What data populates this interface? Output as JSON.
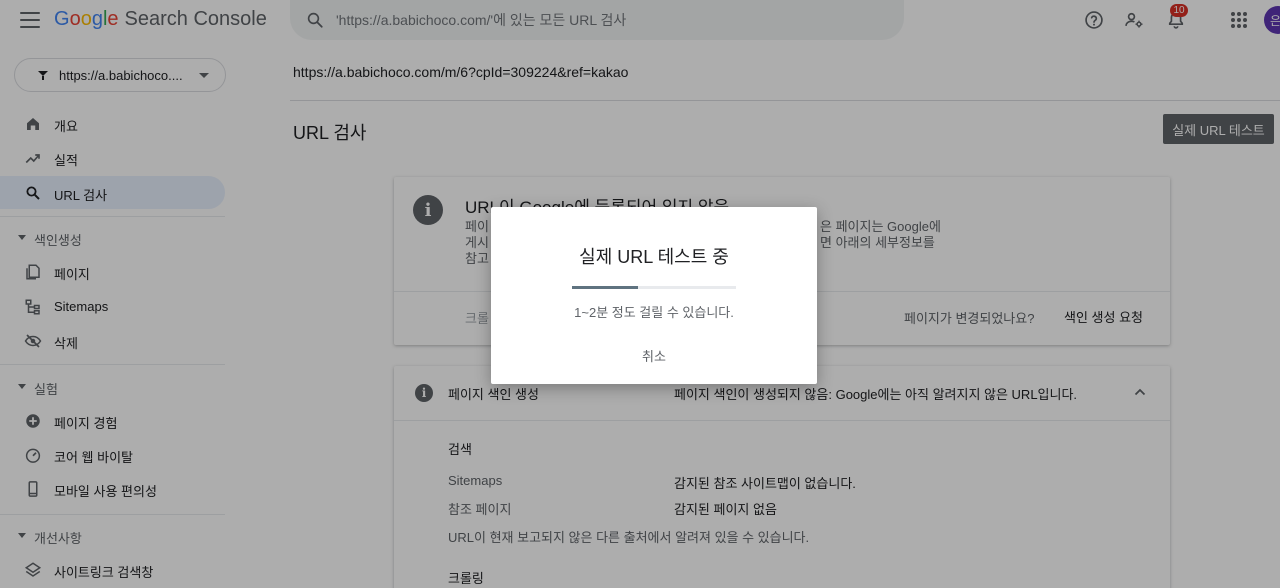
{
  "header": {
    "logo_google": [
      "G",
      "o",
      "o",
      "g",
      "l",
      "e"
    ],
    "logo_product": "Search Console",
    "search_placeholder": "'https://a.babichoco.com/'에 있는 모든 URL 검사",
    "notification_count": "10",
    "avatar_initial": "은"
  },
  "property": {
    "label": "https://a.babichoco...."
  },
  "sidebar": {
    "items": [
      {
        "label": "개요",
        "icon": "home-icon"
      },
      {
        "label": "실적",
        "icon": "trending-icon"
      },
      {
        "label": "URL 검사",
        "icon": "search-icon",
        "active": true
      }
    ],
    "sections": [
      {
        "label": "색인생성",
        "items": [
          {
            "label": "페이지",
            "icon": "pages-icon"
          },
          {
            "label": "Sitemaps",
            "icon": "sitemap-icon"
          },
          {
            "label": "삭제",
            "icon": "removal-icon"
          }
        ]
      },
      {
        "label": "실험",
        "items": [
          {
            "label": "페이지 경험",
            "icon": "plus-circle-icon"
          },
          {
            "label": "코어 웹 바이탈",
            "icon": "gauge-icon"
          },
          {
            "label": "모바일 사용 편의성",
            "icon": "mobile-icon"
          }
        ]
      },
      {
        "label": "개선사항",
        "items": [
          {
            "label": "사이트링크 검색창",
            "icon": "layers-icon"
          }
        ]
      }
    ]
  },
  "main": {
    "inspected_url": "https://a.babichoco.com/m/6?cpId=309224&ref=kakao",
    "page_title": "URL 검사",
    "live_test_button": "실제 URL 테스트",
    "status_card": {
      "title": "URL이 Google에 등록되어 있지 않음",
      "desc_left_lines": [
        "페이",
        "게시",
        "참고"
      ],
      "desc_right_lines": [
        "은 페이지는 Google에",
        "면 아래의 세부정보를"
      ],
      "crawl_label": "크롤",
      "changed_question": "페이지가 변경되었나요?",
      "request_indexing": "색인 생성 요청"
    },
    "index_card": {
      "title": "페이지 색인 생성",
      "status": "페이지 색인이 생성되지 않음: Google에는 아직 알려지지 않은 URL입니다.",
      "discovery_title": "검색",
      "rows": [
        {
          "label": "Sitemaps",
          "value": "감지된 참조 사이트맵이 없습니다."
        },
        {
          "label": "참조 페이지",
          "value": "감지된 페이지 없음"
        }
      ],
      "note": "URL이 현재 보고되지 않은 다른 출처에서 알려져 있을 수 있습니다.",
      "crawl_title": "크롤링"
    }
  },
  "dialog": {
    "title": "실제 URL 테스트 중",
    "progress": 0.4,
    "subtitle": "1~2분 정도 걸릴 수 있습니다.",
    "cancel": "취소"
  },
  "colors": {
    "accent": "#1a73e8",
    "active_nav_bg": "#e8f0fe",
    "badge": "#d93025",
    "avatar": "#5e35b1"
  }
}
